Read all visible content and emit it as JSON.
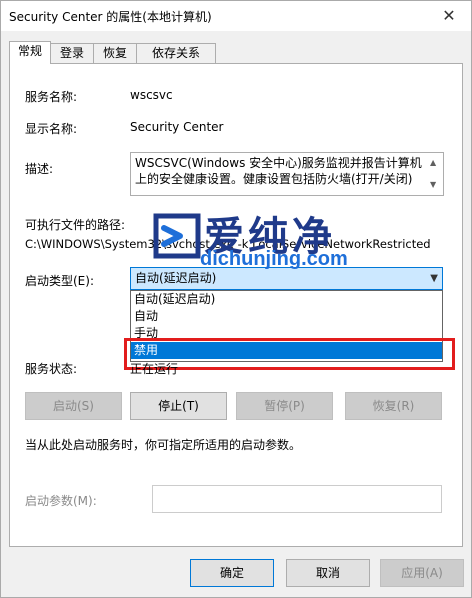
{
  "window": {
    "title": "Security Center 的属性(本地计算机)",
    "close_glyph": "✕"
  },
  "tabs": [
    {
      "label": "常规"
    },
    {
      "label": "登录"
    },
    {
      "label": "恢复"
    },
    {
      "label": "依存关系"
    }
  ],
  "general": {
    "service_name_label": "服务名称:",
    "service_name_value": "wscsvc",
    "display_name_label": "显示名称:",
    "display_name_value": "Security Center",
    "description_label": "描述:",
    "description_value": "WSCSVC(Windows 安全中心)服务监视并报告计算机上的安全健康设置。健康设置包括防火墙(打开/关闭)",
    "exe_path_label": "可执行文件的路径:",
    "exe_path_value": "C:\\WINDOWS\\System32\\svchost.exe -k LocalServiceNetworkRestricted",
    "startup_type_label": "启动类型(E):",
    "startup_type_selected": "自动(延迟启动)",
    "startup_options": [
      "自动(延迟启动)",
      "自动",
      "手动",
      "禁用"
    ],
    "highlighted_option": "禁用",
    "service_status_label": "服务状态:",
    "service_status_value": "正在运行",
    "buttons": {
      "start": "启动(S)",
      "stop": "停止(T)",
      "pause": "暂停(P)",
      "resume": "恢复(R)"
    },
    "hint_text": "当从此处启动服务时，你可指定所适用的启动参数。",
    "start_params_label": "启动参数(M):",
    "start_params_value": ""
  },
  "footer": {
    "ok": "确定",
    "cancel": "取消",
    "apply": "应用(A)"
  },
  "watermark": {
    "title": "爱纯净",
    "url": "dichunjing.com"
  },
  "colors": {
    "accent": "#0078d7",
    "highlight_box": "#e21d1d",
    "watermark_dark": "#1f3a8a",
    "watermark_light": "#1e6fd9"
  }
}
